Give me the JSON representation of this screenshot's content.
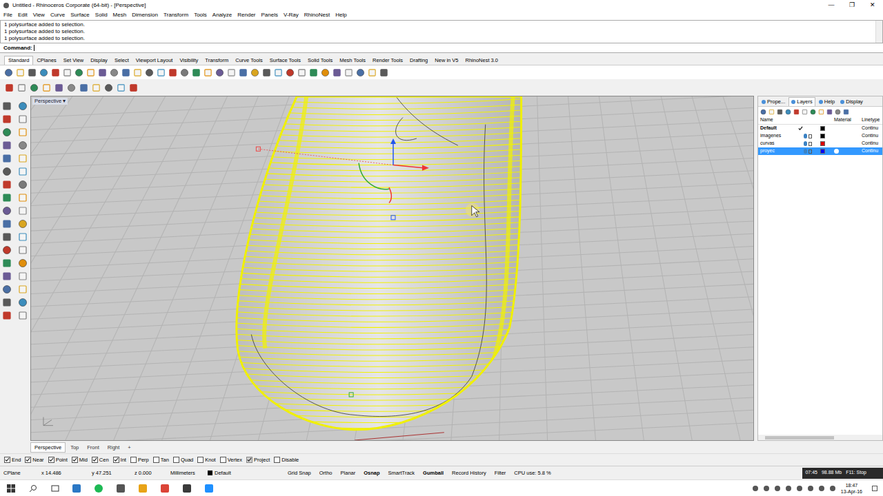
{
  "window": {
    "title": "Untitled - Rhinoceros Corporate (64-bit) - [Perspective]",
    "controls": [
      "—",
      "❐",
      "✕"
    ]
  },
  "menu": [
    "File",
    "Edit",
    "View",
    "Curve",
    "Surface",
    "Solid",
    "Mesh",
    "Dimension",
    "Transform",
    "Tools",
    "Analyze",
    "Render",
    "Panels",
    "V-Ray",
    "RhinoNest",
    "Help"
  ],
  "command_history": [
    "1 polysurface added to selection.",
    "1 polysurface added to selection.",
    "1 polysurface added to selection."
  ],
  "command_prompt": "Command:",
  "toolbar_tabs": [
    {
      "label": "Standard",
      "selected": true
    },
    {
      "label": "CPlanes",
      "selected": false
    },
    {
      "label": "Set View",
      "selected": false
    },
    {
      "label": "Display",
      "selected": false
    },
    {
      "label": "Select",
      "selected": false
    },
    {
      "label": "Viewport Layout",
      "selected": false
    },
    {
      "label": "Visibility",
      "selected": false
    },
    {
      "label": "Transform",
      "selected": false
    },
    {
      "label": "Curve Tools",
      "selected": false
    },
    {
      "label": "Surface Tools",
      "selected": false
    },
    {
      "label": "Solid Tools",
      "selected": false
    },
    {
      "label": "Mesh Tools",
      "selected": false
    },
    {
      "label": "Render Tools",
      "selected": false
    },
    {
      "label": "Drafting",
      "selected": false
    },
    {
      "label": "New in V5",
      "selected": false
    },
    {
      "label": "RhinoNest 3.0",
      "selected": false
    }
  ],
  "viewport": {
    "label": "Perspective"
  },
  "viewport_tabs": [
    {
      "label": "Perspective",
      "selected": true
    },
    {
      "label": "Top",
      "selected": false
    },
    {
      "label": "Front",
      "selected": false
    },
    {
      "label": "Right",
      "selected": false
    },
    {
      "label": "+",
      "selected": false
    }
  ],
  "osnaps": [
    {
      "label": "End",
      "checked": true
    },
    {
      "label": "Near",
      "checked": true
    },
    {
      "label": "Point",
      "checked": true
    },
    {
      "label": "Mid",
      "checked": true
    },
    {
      "label": "Cen",
      "checked": true
    },
    {
      "label": "Int",
      "checked": true
    },
    {
      "label": "Perp",
      "checked": false
    },
    {
      "label": "Tan",
      "checked": false
    },
    {
      "label": "Quad",
      "checked": false
    },
    {
      "label": "Knot",
      "checked": false
    },
    {
      "label": "Vertex",
      "checked": false
    },
    {
      "label": "Project",
      "checked": true
    },
    {
      "label": "Disable",
      "checked": false
    }
  ],
  "status_bar": {
    "cplane": "CPlane",
    "x": "x 14.486",
    "y": "y 47.251",
    "z": "z 0.000",
    "units": "Millimeters",
    "layer": "Default",
    "toggles": [
      {
        "label": "Grid Snap",
        "on": false
      },
      {
        "label": "Ortho",
        "on": false
      },
      {
        "label": "Planar",
        "on": false
      },
      {
        "label": "Osnap",
        "on": true
      },
      {
        "label": "SmartTrack",
        "on": false
      },
      {
        "label": "Gumball",
        "on": true
      },
      {
        "label": "Record History",
        "on": false
      },
      {
        "label": "Filter",
        "on": false
      }
    ],
    "cpu": "CPU use: 5.8 %",
    "time": "07:45",
    "memory": "98.88 Mb",
    "stop": "F11: Stop"
  },
  "panel": {
    "tabs": [
      {
        "label": "Prope...",
        "selected": false
      },
      {
        "label": "Layers",
        "selected": true
      },
      {
        "label": "Help",
        "selected": false
      },
      {
        "label": "Display",
        "selected": false
      }
    ],
    "columns": [
      "Name",
      "Material",
      "Linetype"
    ],
    "layers": [
      {
        "name": "Default",
        "current": true,
        "selected": false,
        "color": "#000000",
        "linetype": "Continu"
      },
      {
        "name": "imagenes",
        "current": false,
        "selected": false,
        "color": "#000000",
        "linetype": "Continu"
      },
      {
        "name": "curvas",
        "current": false,
        "selected": false,
        "color": "#e00000",
        "linetype": "Continu"
      },
      {
        "name": "proyec",
        "current": false,
        "selected": true,
        "color": "#0000ff",
        "linetype": "Continu"
      }
    ]
  },
  "taskbar": {
    "time": "18:47",
    "date": "13-Apr-16"
  }
}
